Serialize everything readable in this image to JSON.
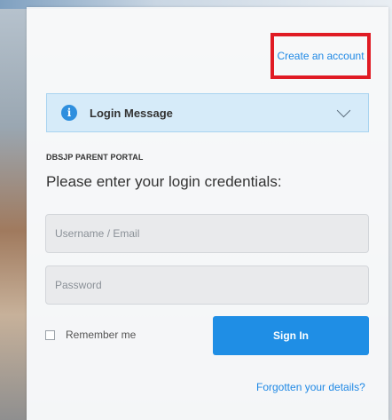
{
  "header": {
    "create_account_label": "Create an account"
  },
  "login_message": {
    "label": "Login Message",
    "icon": "info-icon"
  },
  "portal": {
    "title": "DBSJP PARENT PORTAL",
    "instruction": "Please enter your login credentials:"
  },
  "form": {
    "username": {
      "placeholder": "Username / Email",
      "value": ""
    },
    "password": {
      "placeholder": "Password",
      "value": ""
    },
    "remember_label": "Remember me",
    "remember_checked": false,
    "sign_in_label": "Sign In",
    "forgotten_label": "Forgotten your details?"
  },
  "colors": {
    "accent": "#1f8ee5",
    "highlight_border": "#e01b24",
    "message_bg": "#d6ebf9"
  }
}
